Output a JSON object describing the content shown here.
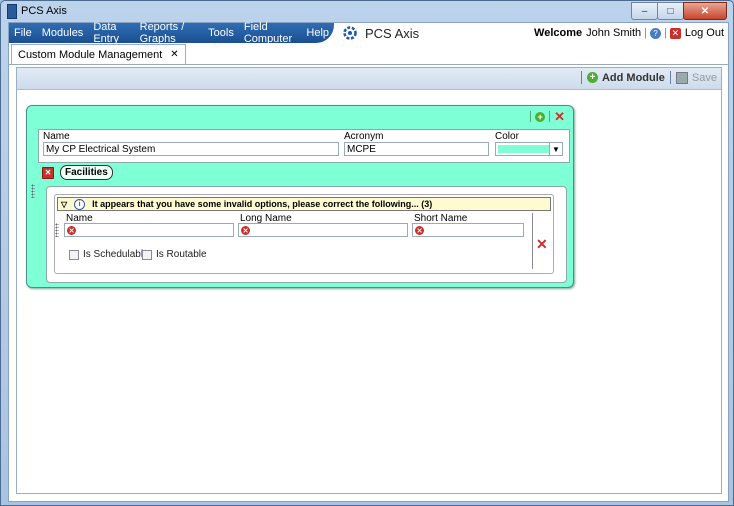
{
  "window": {
    "title": "PCS Axis",
    "controls": [
      "–",
      "□",
      "✕"
    ]
  },
  "menu": {
    "items": [
      "File",
      "Modules",
      "Data Entry",
      "Reports / Graphs",
      "Tools",
      "Field Computer",
      "Help"
    ],
    "brand": "PCS Axis",
    "welcome": "Welcome",
    "user_name": "John Smith",
    "logout": "Log Out"
  },
  "tabs": [
    {
      "label": "Custom Module Management",
      "close": "✕"
    }
  ],
  "toolbar": {
    "add_module": "Add Module",
    "save": "Save"
  },
  "module": {
    "accent_color": "#7effd6",
    "fields": {
      "name_label": "Name",
      "name_value": "My CP Electrical System",
      "acronym_label": "Acronym",
      "acronym_value": "MCPE",
      "color_label": "Color"
    },
    "section": {
      "label": "Facilities",
      "warning": "It appears that you have some invalid options, please correct the following... (3)",
      "name_label": "Name",
      "long_name_label": "Long Name",
      "short_name_label": "Short Name",
      "is_schedulable": "Is Schedulable",
      "is_routable": "Is Routable"
    }
  }
}
